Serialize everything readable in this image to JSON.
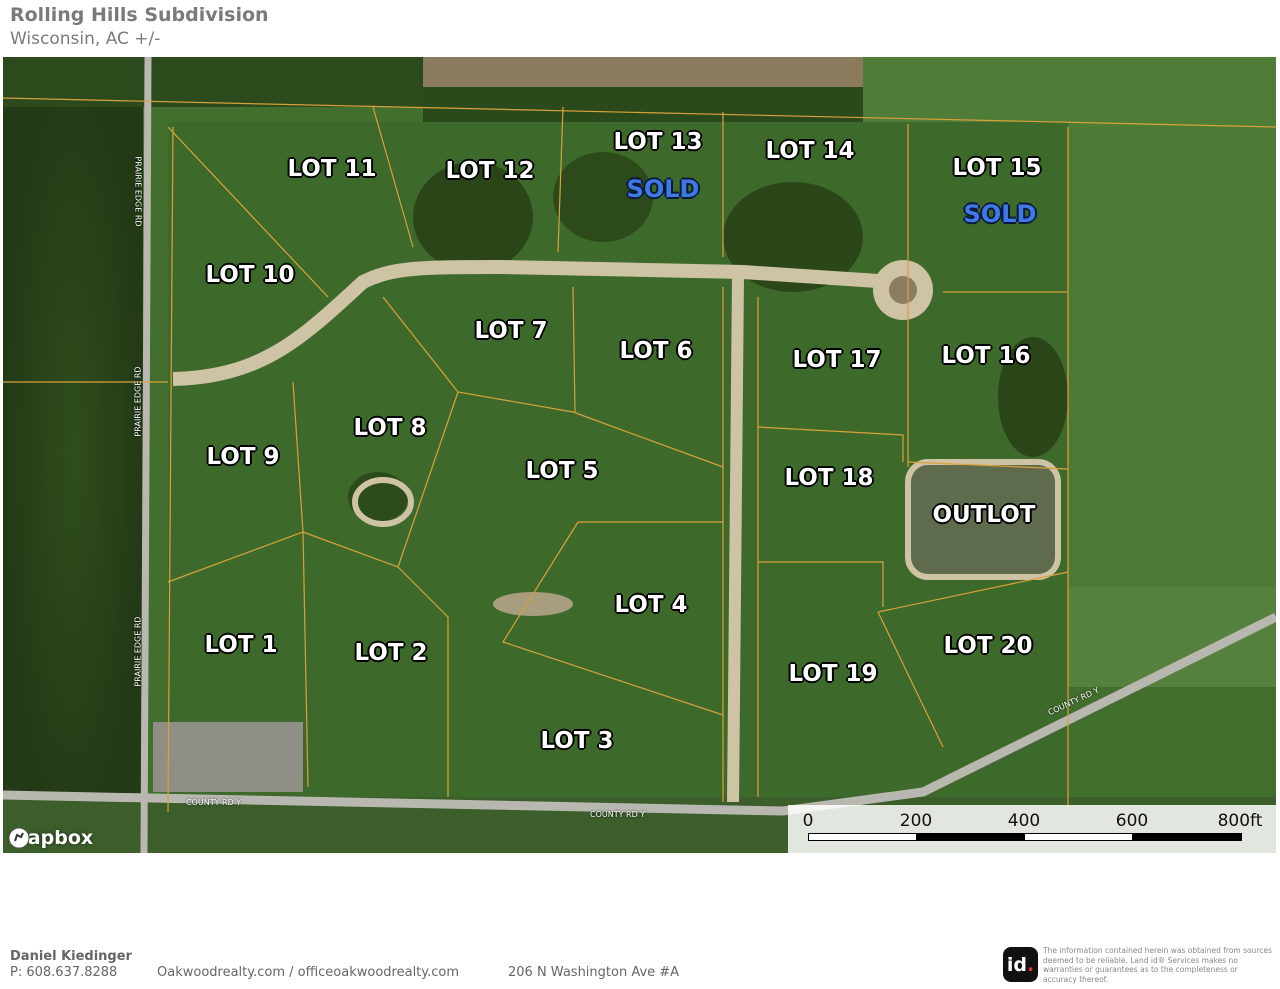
{
  "header": {
    "title": "Rolling Hills Subdivision",
    "subtitle": "Wisconsin,  AC +/-"
  },
  "map": {
    "lots": [
      {
        "key": "lot-11",
        "label": "LOT 11"
      },
      {
        "key": "lot-12",
        "label": "LOT 12"
      },
      {
        "key": "lot-13",
        "label": "LOT 13"
      },
      {
        "key": "lot-14",
        "label": "LOT 14"
      },
      {
        "key": "lot-15",
        "label": "LOT 15"
      },
      {
        "key": "lot-10",
        "label": "LOT 10"
      },
      {
        "key": "lot-7",
        "label": "LOT 7"
      },
      {
        "key": "lot-6",
        "label": "LOT 6"
      },
      {
        "key": "lot-17",
        "label": "LOT 17"
      },
      {
        "key": "lot-16",
        "label": "LOT 16"
      },
      {
        "key": "lot-8",
        "label": "LOT 8"
      },
      {
        "key": "lot-9",
        "label": "LOT 9"
      },
      {
        "key": "lot-5",
        "label": "LOT 5"
      },
      {
        "key": "lot-18",
        "label": "LOT 18"
      },
      {
        "key": "outlot",
        "label": "OUTLOT"
      },
      {
        "key": "lot-4",
        "label": "LOT 4"
      },
      {
        "key": "lot-1",
        "label": "LOT 1"
      },
      {
        "key": "lot-2",
        "label": "LOT 2"
      },
      {
        "key": "lot-20",
        "label": "LOT 20"
      },
      {
        "key": "lot-19",
        "label": "LOT 19"
      },
      {
        "key": "lot-3",
        "label": "LOT 3"
      }
    ],
    "sold_labels": [
      {
        "key": "lot-13-sold",
        "label": "SOLD"
      },
      {
        "key": "lot-15-sold",
        "label": "SOLD"
      }
    ],
    "road_labels": {
      "prairie_edge_rd": "PRAIRIE EDGE RD",
      "county_rd_y": "COUNTY RD Y"
    },
    "attribution": "mapbox",
    "scale": {
      "labels": [
        "0",
        "200",
        "400",
        "600",
        "800ft"
      ]
    }
  },
  "footer": {
    "agent_name": "Daniel Kiedinger",
    "phone": "P: 608.637.8288",
    "website": "Oakwoodrealty.com  / officeoakwoodrealty.com",
    "address": "206 N Washington Ave #A",
    "logo_text": "id",
    "disclaimer": "The information contained herein was obtained from sources deemed to be reliable. Land id® Services makes no warranties or guarantees as to the completeness or accuracy thereof."
  },
  "colors": {
    "lot_text": "#ffffff",
    "sold_text": "#3f79e6",
    "boundary": "#d9a13a",
    "road": "#cfc3a6",
    "field": "#3f6a2c"
  }
}
